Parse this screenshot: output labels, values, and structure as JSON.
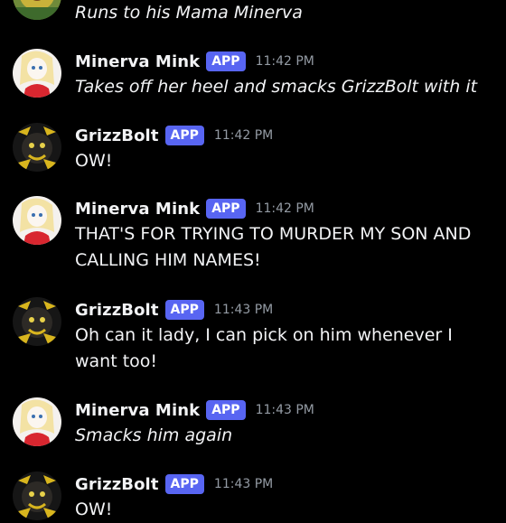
{
  "colors": {
    "background": "#000000",
    "text": "#f2f3f5",
    "muted": "#949ba4",
    "app_badge": "#5865f2"
  },
  "messages": [
    {
      "author": "",
      "badge": "",
      "time": "",
      "avatar": "sunflower-avatar",
      "text": "Runs to his Mama Minerva",
      "italic": true
    },
    {
      "author": "Minerva Mink",
      "badge": "APP",
      "time": "11:42 PM",
      "avatar": "minerva-avatar",
      "text": "Takes off her heel and smacks GrizzBolt with it",
      "italic": true
    },
    {
      "author": "GrizzBolt",
      "badge": "APP",
      "time": "11:42 PM",
      "avatar": "grizzbolt-avatar",
      "text": "OW!",
      "italic": false
    },
    {
      "author": "Minerva Mink",
      "badge": "APP",
      "time": "11:42 PM",
      "avatar": "minerva-avatar",
      "text": "THAT'S FOR TRYING TO MURDER MY SON AND CALLING HIM NAMES!",
      "italic": false
    },
    {
      "author": "GrizzBolt",
      "badge": "APP",
      "time": "11:43 PM",
      "avatar": "grizzbolt-avatar",
      "text": "Oh can it lady, I can pick on him whenever I want too!",
      "italic": false
    },
    {
      "author": "Minerva Mink",
      "badge": "APP",
      "time": "11:43 PM",
      "avatar": "minerva-avatar",
      "text": "Smacks him again",
      "italic": true
    },
    {
      "author": "GrizzBolt",
      "badge": "APP",
      "time": "11:43 PM",
      "avatar": "grizzbolt-avatar",
      "text": "OW!",
      "italic": false
    }
  ]
}
